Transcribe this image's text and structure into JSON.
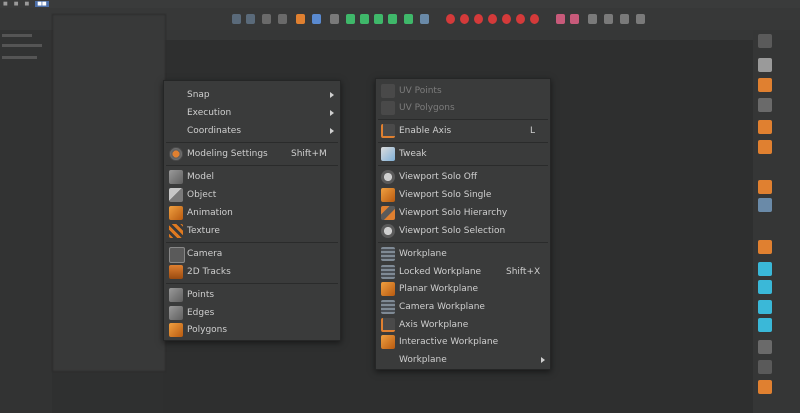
{
  "colors": {
    "background": "#2f3030",
    "menu_bg": "#3a3b3b",
    "text": "#cfcfcf",
    "disabled_text": "#7c7c7c",
    "accent_orange": "#e08030",
    "accent_blue": "#4b6ea8"
  },
  "menu_left": {
    "items": [
      {
        "label": "Snap",
        "submenu": true,
        "icon": ""
      },
      {
        "label": "Execution",
        "submenu": true,
        "icon": ""
      },
      {
        "label": "Coordinates",
        "submenu": true,
        "icon": ""
      },
      {
        "label": "Modeling Settings",
        "shortcut": "Shift+M",
        "icon": "modeling-settings-icon"
      },
      {
        "label": "Model",
        "icon": "model-icon"
      },
      {
        "label": "Object",
        "icon": "object-icon"
      },
      {
        "label": "Animation",
        "icon": "animation-icon"
      },
      {
        "label": "Texture",
        "icon": "texture-icon"
      },
      {
        "label": "Camera",
        "icon": "camera-icon"
      },
      {
        "label": "2D Tracks",
        "icon": "2d-tracks-icon"
      },
      {
        "label": "Points",
        "icon": "points-icon"
      },
      {
        "label": "Edges",
        "icon": "edges-icon"
      },
      {
        "label": "Polygons",
        "icon": "polygons-icon"
      }
    ]
  },
  "menu_right": {
    "items": [
      {
        "label": "UV Points",
        "disabled": true,
        "icon": "uv-points-icon"
      },
      {
        "label": "UV Polygons",
        "disabled": true,
        "icon": "uv-polygons-icon"
      },
      {
        "label": "Enable Axis",
        "shortcut": "L",
        "icon": "enable-axis-icon"
      },
      {
        "label": "Tweak",
        "icon": "tweak-icon"
      },
      {
        "label": "Viewport Solo Off",
        "icon": "viewport-solo-off-icon"
      },
      {
        "label": "Viewport Solo Single",
        "icon": "viewport-solo-single-icon"
      },
      {
        "label": "Viewport Solo Hierarchy",
        "icon": "viewport-solo-hierarchy-icon"
      },
      {
        "label": "Viewport Solo Selection",
        "icon": "viewport-solo-selection-icon"
      },
      {
        "label": "Workplane",
        "icon": "workplane-icon"
      },
      {
        "label": "Locked Workplane",
        "shortcut": "Shift+X",
        "icon": "locked-workplane-icon"
      },
      {
        "label": "Planar Workplane",
        "icon": "planar-workplane-icon"
      },
      {
        "label": "Camera Workplane",
        "icon": "camera-workplane-icon"
      },
      {
        "label": "Axis Workplane",
        "icon": "axis-workplane-icon"
      },
      {
        "label": "Interactive Workplane",
        "icon": "interactive-workplane-icon"
      },
      {
        "label": "Workplane",
        "submenu": true,
        "icon": ""
      }
    ]
  }
}
